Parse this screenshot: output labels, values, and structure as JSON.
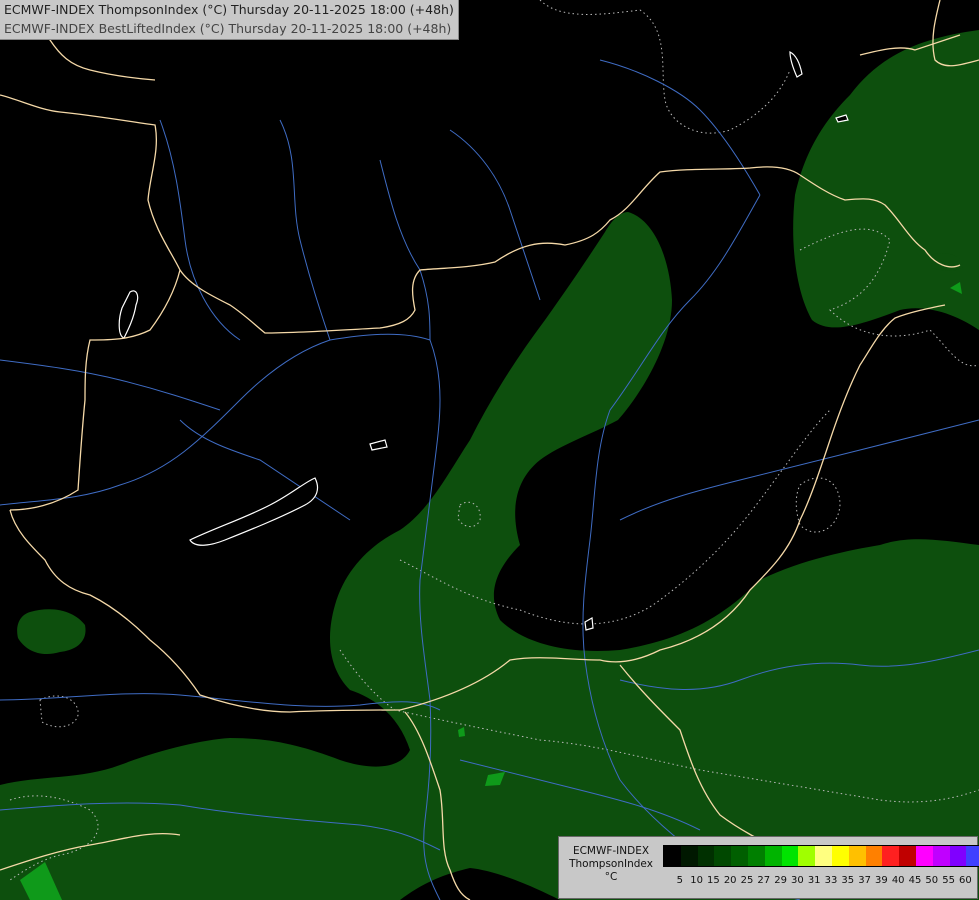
{
  "header": {
    "line1": "ECMWF-INDEX ThompsonIndex (°C) Thursday 20-11-2025 18:00 (+48h)",
    "line2": "ECMWF-INDEX BestLiftedIndex (°C) Thursday 20-11-2025 18:00 (+48h)"
  },
  "legend": {
    "model": "ECMWF-INDEX",
    "parameter": "ThompsonIndex",
    "unit": "°C",
    "ticks": [
      "5",
      "10",
      "15",
      "20",
      "25",
      "27",
      "29",
      "30",
      "31",
      "33",
      "35",
      "37",
      "39",
      "40",
      "45",
      "50",
      "55",
      "60"
    ],
    "colors": [
      "#000000",
      "#001800",
      "#003000",
      "#004800",
      "#005f00",
      "#007f00",
      "#00b400",
      "#00e400",
      "#a0ff00",
      "#ffff80",
      "#ffff00",
      "#ffc000",
      "#ff8000",
      "#ff2020",
      "#c00000",
      "#ff00ff",
      "#c000ff",
      "#8000ff",
      "#4040ff",
      "#0000ff"
    ]
  },
  "map_colors": {
    "background": "#000000",
    "fill_green": "#0d4f0d",
    "fill_green_bright": "#0f9a1a",
    "border": "#f5d9a8",
    "river": "#3f6cc4",
    "contour": "#bbbbbb",
    "lake": "#ffffff"
  }
}
